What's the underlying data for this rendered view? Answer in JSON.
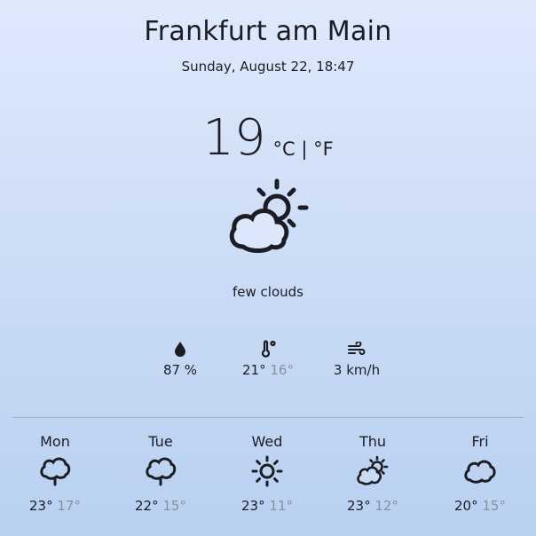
{
  "location": {
    "city": "Frankfurt am Main",
    "datetime": "Sunday, August 22, 18:47"
  },
  "current": {
    "temperature": "19",
    "unit_c": "°C",
    "unit_sep": "|",
    "unit_f": "°F",
    "icon": "sun-behind-cloud-icon",
    "description": "few clouds"
  },
  "details": {
    "humidity": {
      "icon": "water-drop-icon",
      "value": "87 %"
    },
    "temp_range": {
      "icon": "thermometer-icon",
      "high": "21°",
      "low": "16°"
    },
    "wind": {
      "icon": "wind-icon",
      "value": "3 km/h"
    }
  },
  "forecast": [
    {
      "day": "Mon",
      "icon": "rain-cloud-icon",
      "high": "23°",
      "low": "17°"
    },
    {
      "day": "Tue",
      "icon": "rain-cloud-icon",
      "high": "22°",
      "low": "15°"
    },
    {
      "day": "Wed",
      "icon": "sun-icon",
      "high": "23°",
      "low": "11°"
    },
    {
      "day": "Thu",
      "icon": "sun-behind-cloud-icon",
      "high": "23°",
      "low": "12°"
    },
    {
      "day": "Fri",
      "icon": "cloud-icon",
      "high": "20°",
      "low": "15°"
    }
  ],
  "colors": {
    "text": "#1c1c24",
    "muted": "#8a8f9c",
    "bg_top": "#dfe9fc",
    "bg_bottom": "#b9d0f1"
  }
}
